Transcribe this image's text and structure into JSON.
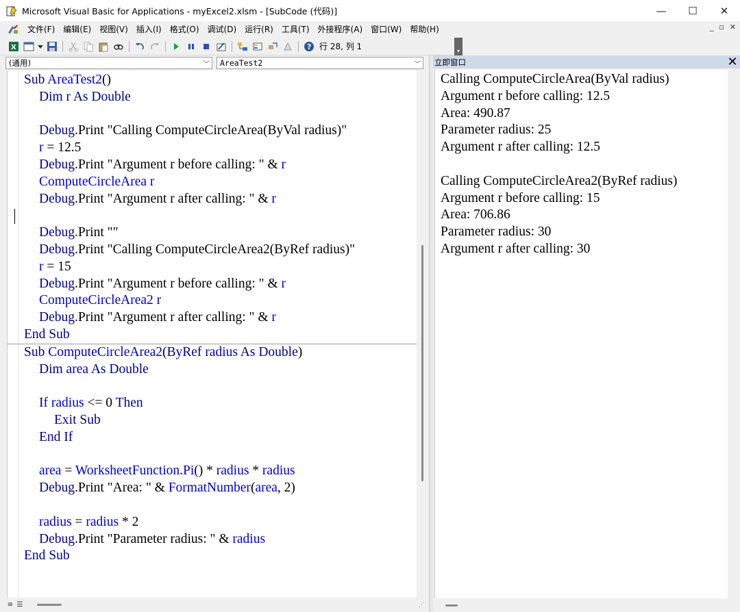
{
  "window": {
    "title": "Microsoft Visual Basic for Applications - myExcel2.xlsm - [SubCode (代码)]",
    "minimize": "—",
    "maximize": "☐",
    "close": "✕"
  },
  "menubar": {
    "items": [
      "文件(F)",
      "编辑(E)",
      "视图(V)",
      "插入(I)",
      "格式(O)",
      "调试(D)",
      "运行(R)",
      "工具(T)",
      "外接程序(A)",
      "窗口(W)",
      "帮助(H)"
    ],
    "mdi_minimize": "_",
    "mdi_restore": "▫",
    "mdi_close": "✕"
  },
  "toolbar": {
    "status": "行 28, 列 1",
    "icons": [
      "excel-icon",
      "insert-userform-icon",
      "save-icon",
      "cut-icon",
      "copy-icon",
      "paste-icon",
      "find-icon",
      "undo-icon",
      "redo-icon",
      "run-icon",
      "break-icon",
      "reset-icon",
      "design-mode-icon",
      "project-explorer-icon",
      "properties-icon",
      "object-browser-icon",
      "toolbox-icon",
      "help-icon"
    ]
  },
  "code_window": {
    "object_combo": "(通用)",
    "procedure_combo": "AreaTest2",
    "lines": [
      {
        "indent": 0,
        "segs": [
          [
            "kw",
            "Sub "
          ],
          [
            "id",
            "AreaTest2"
          ],
          [
            "",
            "()"
          ]
        ]
      },
      {
        "indent": 1,
        "segs": [
          [
            "kw",
            "Dim "
          ],
          [
            "kw",
            "r "
          ],
          [
            "kw",
            "As Double"
          ]
        ]
      },
      {
        "indent": 0,
        "segs": []
      },
      {
        "indent": 1,
        "segs": [
          [
            "kw",
            "Debug"
          ],
          [
            "",
            ".Print \"Calling ComputeCircleArea(ByVal radius)\""
          ]
        ]
      },
      {
        "indent": 1,
        "segs": [
          [
            "id",
            "r"
          ],
          [
            "",
            " = 12.5"
          ]
        ]
      },
      {
        "indent": 1,
        "segs": [
          [
            "kw",
            "Debug"
          ],
          [
            "",
            ".Print \"Argument r before calling: \" & "
          ],
          [
            "id",
            "r"
          ]
        ]
      },
      {
        "indent": 1,
        "segs": [
          [
            "id",
            "ComputeCircleArea r"
          ]
        ]
      },
      {
        "indent": 1,
        "segs": [
          [
            "kw",
            "Debug"
          ],
          [
            "",
            ".Print \"Argument r after calling: \" & "
          ],
          [
            "id",
            "r"
          ]
        ]
      },
      {
        "indent": 0,
        "segs": [],
        "caret": true
      },
      {
        "indent": 1,
        "segs": [
          [
            "kw",
            "Debug"
          ],
          [
            "",
            ".Print \"\""
          ]
        ]
      },
      {
        "indent": 1,
        "segs": [
          [
            "kw",
            "Debug"
          ],
          [
            "",
            ".Print \"Calling ComputeCircleArea2(ByRef radius)\""
          ]
        ]
      },
      {
        "indent": 1,
        "segs": [
          [
            "id",
            "r"
          ],
          [
            "",
            " = 15"
          ]
        ]
      },
      {
        "indent": 1,
        "segs": [
          [
            "kw",
            "Debug"
          ],
          [
            "",
            ".Print \"Argument r before calling: \" & "
          ],
          [
            "id",
            "r"
          ]
        ]
      },
      {
        "indent": 1,
        "segs": [
          [
            "id",
            "ComputeCircleArea2 r"
          ]
        ]
      },
      {
        "indent": 1,
        "segs": [
          [
            "kw",
            "Debug"
          ],
          [
            "",
            ".Print \"Argument r after calling: \" & "
          ],
          [
            "id",
            "r"
          ]
        ]
      },
      {
        "indent": 0,
        "segs": [
          [
            "kw",
            "End Sub"
          ]
        ]
      },
      {
        "separator": true
      },
      {
        "indent": 0,
        "segs": [
          [
            "kw",
            "Sub "
          ],
          [
            "id",
            "ComputeCircleArea2"
          ],
          [
            "",
            "("
          ],
          [
            "kw",
            "ByRef "
          ],
          [
            "id",
            "radius "
          ],
          [
            "kw",
            "As Double"
          ],
          [
            "",
            ")"
          ]
        ]
      },
      {
        "indent": 1,
        "segs": [
          [
            "kw",
            "Dim "
          ],
          [
            "id",
            "area "
          ],
          [
            "kw",
            "As Double"
          ]
        ]
      },
      {
        "indent": 0,
        "segs": []
      },
      {
        "indent": 1,
        "segs": [
          [
            "kw",
            "If "
          ],
          [
            "id",
            "radius"
          ],
          [
            "",
            " <= 0 "
          ],
          [
            "kw",
            "Then"
          ]
        ]
      },
      {
        "indent": 2,
        "segs": [
          [
            "kw",
            "Exit Sub"
          ]
        ]
      },
      {
        "indent": 1,
        "segs": [
          [
            "kw",
            "End If"
          ]
        ]
      },
      {
        "indent": 0,
        "segs": []
      },
      {
        "indent": 1,
        "segs": [
          [
            "id",
            "area"
          ],
          [
            "",
            " = "
          ],
          [
            "id",
            "WorksheetFunction"
          ],
          [
            "",
            "."
          ],
          [
            "id",
            "Pi"
          ],
          [
            "",
            "() * "
          ],
          [
            "id",
            "radius"
          ],
          [
            "",
            " * "
          ],
          [
            "id",
            "radius"
          ]
        ]
      },
      {
        "indent": 1,
        "segs": [
          [
            "kw",
            "Debug"
          ],
          [
            "",
            ".Print \"Area: \" & "
          ],
          [
            "id",
            "FormatNumber"
          ],
          [
            "",
            "("
          ],
          [
            "id",
            "area"
          ],
          [
            "",
            ", 2)"
          ]
        ]
      },
      {
        "indent": 0,
        "segs": []
      },
      {
        "indent": 1,
        "segs": [
          [
            "id",
            "radius"
          ],
          [
            "",
            " = "
          ],
          [
            "id",
            "radius"
          ],
          [
            "",
            " * 2"
          ]
        ]
      },
      {
        "indent": 1,
        "segs": [
          [
            "kw",
            "Debug"
          ],
          [
            "",
            ".Print \"Parameter radius: \" & "
          ],
          [
            "id",
            "radius"
          ]
        ]
      },
      {
        "indent": 0,
        "segs": [
          [
            "kw",
            "End Sub"
          ]
        ]
      }
    ]
  },
  "immediate_window": {
    "title": "立即窗口",
    "close": "✕",
    "lines": [
      "Calling ComputeCircleArea(ByVal radius)",
      "Argument r before calling: 12.5",
      "Area: 490.87",
      "Parameter radius: 25",
      "Argument r after calling: 12.5",
      "",
      "Calling ComputeCircleArea2(ByRef radius)",
      "Argument r before calling: 15",
      "Area: 706.86",
      "Parameter radius: 30",
      "Argument r after calling: 30"
    ]
  },
  "colors": {
    "keyword": "#00008b",
    "identifier": "#0000cc",
    "text": "#000000",
    "immediate_header": "#cfd9e8"
  }
}
